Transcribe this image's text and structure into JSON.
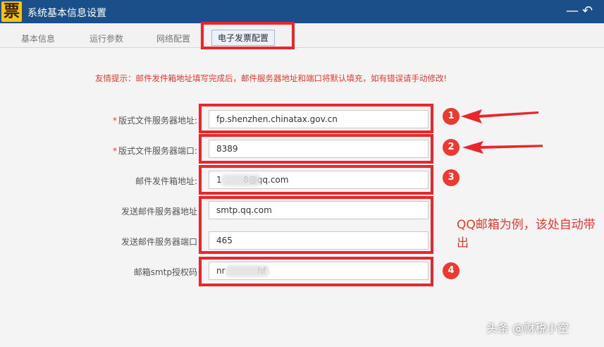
{
  "window": {
    "logo_char": "票",
    "title": "系统基本信息设置",
    "minimize_glyph": "—",
    "back_glyph": "↶"
  },
  "tabs": [
    {
      "label": "基本信息"
    },
    {
      "label": "运行参数"
    },
    {
      "label": "网络配置"
    },
    {
      "label": "电子发票配置"
    }
  ],
  "hint": "友情提示：邮件发件箱地址填写完成后，邮件服务器地址和端口将默认填充，如有错误请手动修改!",
  "form": {
    "layout_server_address": {
      "required_mark": "*",
      "label": "版式文件服务器地址:",
      "value": "fp.shenzhen.chinatax.gov.cn"
    },
    "layout_server_port": {
      "required_mark": "*",
      "label": "版式文件服务器端口:",
      "value": "8389"
    },
    "sender_email": {
      "label": "邮件发件箱地址:",
      "value": "1        8@qq.com"
    },
    "smtp_server_address": {
      "label": "发送邮件服务器地址",
      "value": "smtp.qq.com"
    },
    "smtp_server_port": {
      "label": "发送邮件服务器端口",
      "value": "465"
    },
    "smtp_auth_code": {
      "label": "邮箱smtp授权码",
      "value": "nr            hf"
    }
  },
  "annotations": {
    "badges": [
      "1",
      "2",
      "3",
      "4"
    ],
    "note": "QQ邮箱为例，该处自动带出",
    "accent": "#e8262b"
  },
  "watermark": "头条 @财税小空"
}
